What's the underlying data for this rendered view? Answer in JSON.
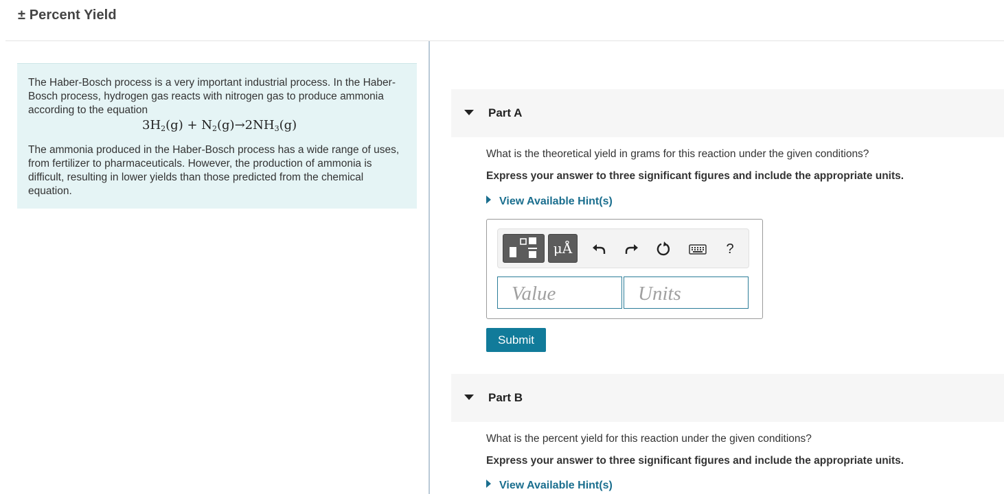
{
  "page": {
    "title": "± Percent Yield"
  },
  "intro": {
    "paragraph1": "The Haber-Bosch process is a very important industrial process. In the Haber-Bosch process, hydrogen gas reacts with nitrogen gas to produce ammonia according to the equation",
    "equation": {
      "h2_coef": "3H",
      "h2_sub": "2",
      "h2_state": "(g) + N",
      "n2_sub": "2",
      "n2_state": "(g)→2NH",
      "nh3_sub": "3",
      "nh3_state": "(g)"
    },
    "paragraph2": "The ammonia produced in the Haber-Bosch process has a wide range of uses, from fertilizer to pharmaceuticals. However, the production of ammonia is difficult, resulting in lower yields than those predicted from the chemical equation."
  },
  "part_a": {
    "title": "Part A",
    "question": "What is the theoretical yield in grams for this reaction under the given conditions?",
    "instruction": "Express your answer to three significant figures and include the appropriate units.",
    "hint_label": "View Available Hint(s)",
    "toolbar": {
      "units_label": "μÅ",
      "help_label": "?",
      "icons": [
        "templates-icon",
        "units-icon",
        "undo-icon",
        "redo-icon",
        "reset-icon",
        "keyboard-icon",
        "help-icon"
      ]
    },
    "value_placeholder": "Value",
    "units_placeholder": "Units",
    "submit_label": "Submit"
  },
  "part_b": {
    "title": "Part B",
    "question": "What is the percent yield for this reaction under the given conditions?",
    "instruction": "Express your answer to three significant figures and include the appropriate units.",
    "hint_label": "View Available Hint(s)"
  },
  "colors": {
    "accent": "#117b9a",
    "link": "#1a6e8e",
    "intro_background": "#e5f4f5",
    "part_header_background": "#f6f6f6"
  }
}
